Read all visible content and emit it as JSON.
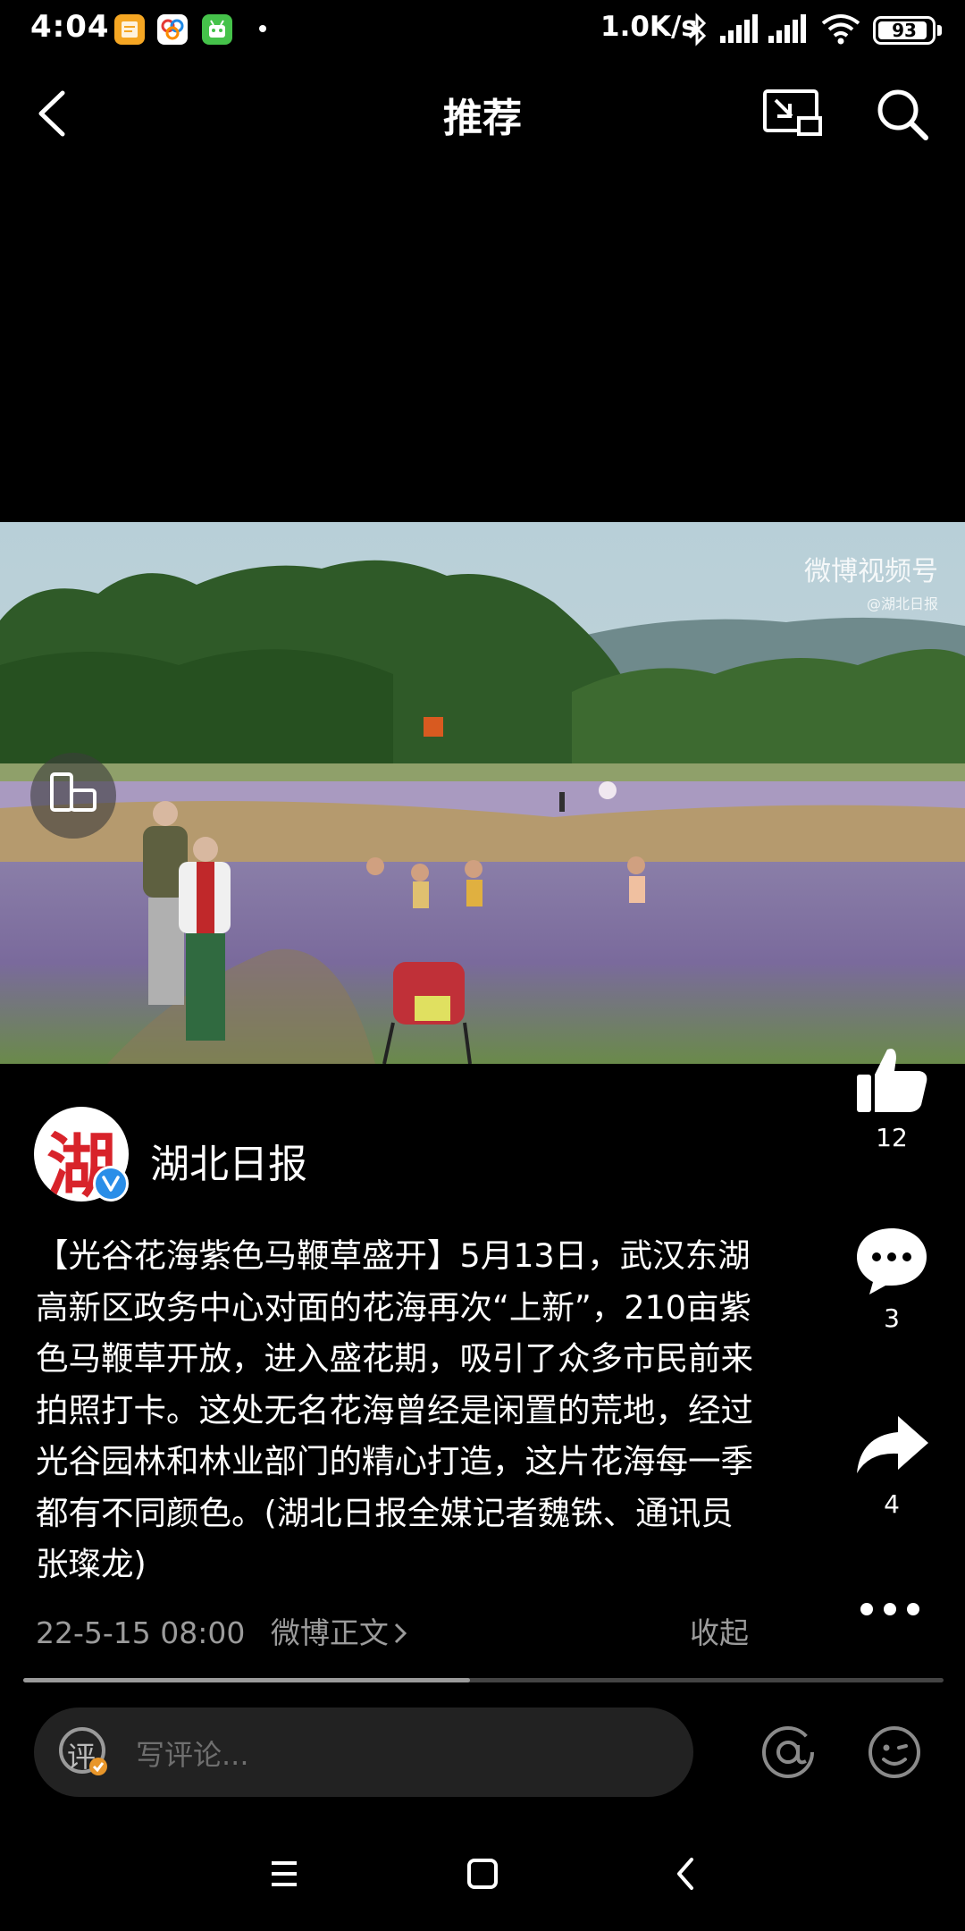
{
  "status_bar": {
    "time": "4:04",
    "speed": "1.0K/s",
    "battery": "93",
    "battery_level": 0.93,
    "icons": [
      "notes-app-icon",
      "baidu-app-icon",
      "android-app-icon",
      "bluetooth-icon",
      "signal-icon",
      "wifi-icon",
      "battery-icon"
    ]
  },
  "header": {
    "title": "推荐",
    "icons": [
      "back-icon",
      "cast-icon",
      "search-icon"
    ]
  },
  "video": {
    "watermark_main": "微博视频号",
    "watermark_sub": "@湖北日报",
    "progress": 0.485
  },
  "actions": {
    "like_count": "12",
    "comment_count": "3",
    "share_count": "4"
  },
  "author": {
    "name": "湖北日报",
    "avatar_char": "湖"
  },
  "post": {
    "text": "【光谷花海紫色马鞭草盛开】5月13日，武汉东湖高新区政务中心对面的花海再次“上新”，210亩紫色马鞭草开放，进入盛花期，吸引了众多市民前来拍照打卡。这处无名花海曾经是闲置的荒地，经过光谷园林和林业部门的精心打造，这片花海每一季都有不同颜色。(湖北日报全媒记者魏铢、通讯员张璨龙)",
    "date": "22-5-15 08:00",
    "source_link": "微博正文",
    "collapse": "收起"
  },
  "comment_bar": {
    "badge_char": "评",
    "placeholder": "写评论..."
  },
  "colors": {
    "background": "#000000",
    "secondary_text": "#9b9b9b",
    "verified": "#2a8ee8",
    "avatar_red": "#d8232a"
  }
}
